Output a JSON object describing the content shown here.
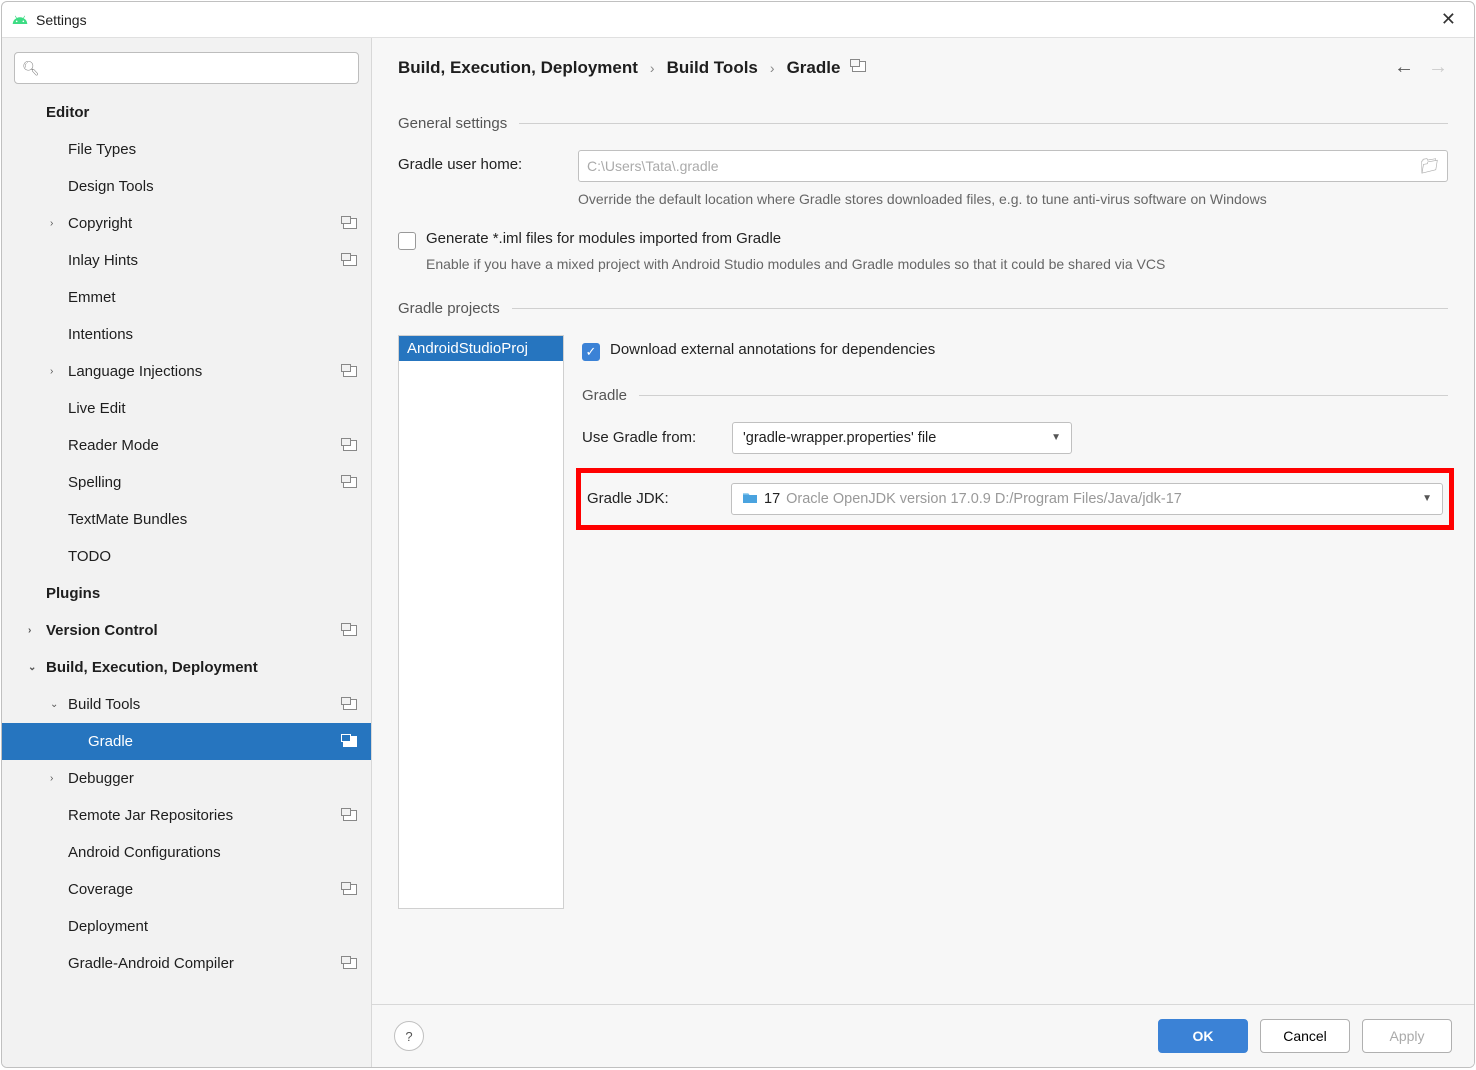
{
  "window": {
    "title": "Settings"
  },
  "breadcrumb": {
    "parts": [
      "Build, Execution, Deployment",
      "Build Tools",
      "Gradle"
    ]
  },
  "sidebar": {
    "items": [
      {
        "label": "Editor",
        "bold": true,
        "indent": "indent-0"
      },
      {
        "label": "File Types",
        "indent": "indent-1"
      },
      {
        "label": "Design Tools",
        "indent": "indent-1"
      },
      {
        "label": "Copyright",
        "chev": "›",
        "indent": "has-chev-1",
        "ov": true
      },
      {
        "label": "Inlay Hints",
        "indent": "indent-1",
        "ov": true
      },
      {
        "label": "Emmet",
        "indent": "indent-1"
      },
      {
        "label": "Intentions",
        "indent": "indent-1"
      },
      {
        "label": "Language Injections",
        "chev": "›",
        "indent": "has-chev-1",
        "ov": true
      },
      {
        "label": "Live Edit",
        "indent": "indent-1"
      },
      {
        "label": "Reader Mode",
        "indent": "indent-1",
        "ov": true
      },
      {
        "label": "Spelling",
        "indent": "indent-1",
        "ov": true
      },
      {
        "label": "TextMate Bundles",
        "indent": "indent-1"
      },
      {
        "label": "TODO",
        "indent": "indent-1"
      },
      {
        "label": "Plugins",
        "bold": true,
        "indent": "indent-0"
      },
      {
        "label": "Version Control",
        "bold": true,
        "chev": "›",
        "indent": "has-chev-0",
        "ov": true
      },
      {
        "label": "Build, Execution, Deployment",
        "bold": true,
        "chev": "⌄",
        "indent": "has-chev-0"
      },
      {
        "label": "Build Tools",
        "chev": "⌄",
        "indent": "has-chev-1",
        "ov": true
      },
      {
        "label": "Gradle",
        "indent": "indent-2",
        "ov": true,
        "selected": true
      },
      {
        "label": "Debugger",
        "chev": "›",
        "indent": "has-chev-1"
      },
      {
        "label": "Remote Jar Repositories",
        "indent": "indent-1",
        "ov": true
      },
      {
        "label": "Android Configurations",
        "indent": "indent-1"
      },
      {
        "label": "Coverage",
        "indent": "indent-1",
        "ov": true
      },
      {
        "label": "Deployment",
        "indent": "indent-1"
      },
      {
        "label": "Gradle-Android Compiler",
        "indent": "indent-1",
        "ov": true
      }
    ]
  },
  "sections": {
    "general": "General settings",
    "gradle_projects": "Gradle projects",
    "gradle": "Gradle"
  },
  "general": {
    "user_home_label": "Gradle user home:",
    "user_home_placeholder": "C:\\Users\\Tata\\.gradle",
    "user_home_hint": "Override the default location where Gradle stores downloaded files, e.g. to tune anti-virus software on Windows",
    "generate_iml_label": "Generate *.iml files for modules imported from Gradle",
    "generate_iml_hint": "Enable if you have a mixed project with Android Studio modules and Gradle modules so that it could be shared via VCS"
  },
  "project": {
    "selected": "AndroidStudioProj",
    "download_annotations_label": "Download external annotations for dependencies",
    "use_gradle_from_label": "Use Gradle from:",
    "use_gradle_from_value": "'gradle-wrapper.properties' file",
    "jdk_label": "Gradle JDK:",
    "jdk_version": "17",
    "jdk_detail": "Oracle OpenJDK version 17.0.9 D:/Program Files/Java/jdk-17"
  },
  "footer": {
    "ok": "OK",
    "cancel": "Cancel",
    "apply": "Apply",
    "help": "?"
  }
}
